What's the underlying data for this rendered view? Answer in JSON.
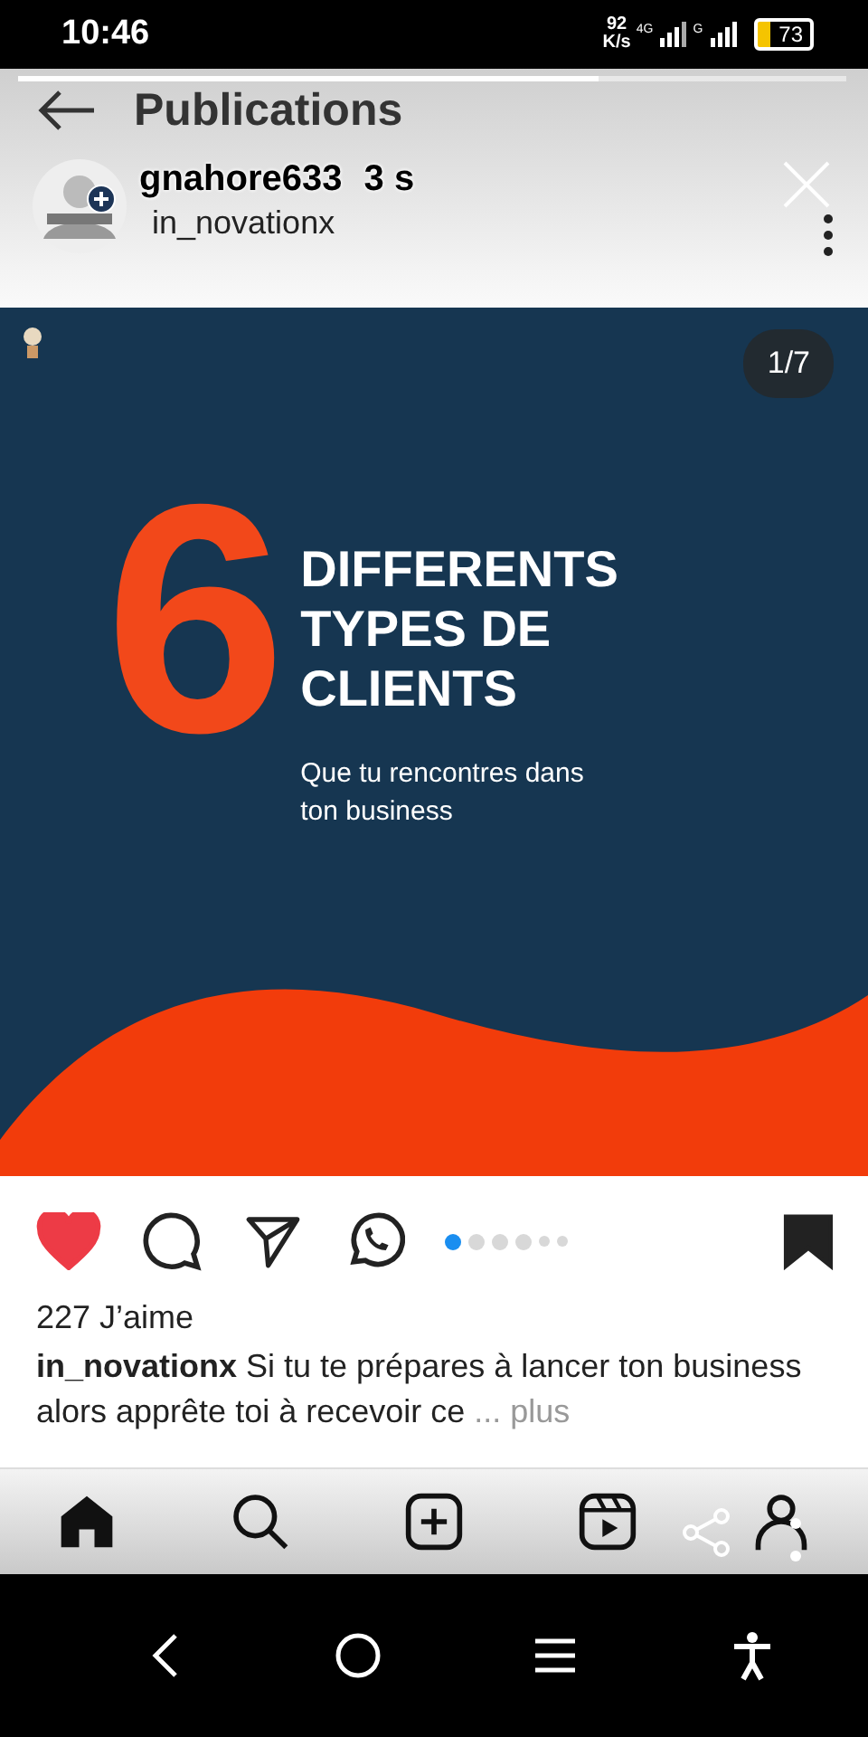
{
  "status_bar": {
    "time": "10:46",
    "speed_value": "92",
    "speed_unit": "K/s",
    "network_1": "4G",
    "network_2": "G",
    "battery": "73"
  },
  "viewer": {
    "progress": {
      "level": 0.7
    },
    "owner": "gnahore633",
    "age": "3 s"
  },
  "screenshot": {
    "title": "Publications",
    "account": "in_novationx",
    "slide": {
      "counter": "1/7",
      "number": "6",
      "headline": [
        "DIFFERENTS",
        "TYPES DE",
        "CLIENTS"
      ],
      "subtitle": [
        "Que tu rencontres dans",
        "ton business"
      ]
    },
    "liked": true,
    "saved": true,
    "carousel_dots": [
      {
        "selected": true
      },
      {
        "selected": false
      },
      {
        "selected": false
      },
      {
        "selected": false
      },
      {
        "selected": false
      },
      {
        "selected": false
      }
    ],
    "likes": "227 J’aime",
    "caption_user": "in_novationx",
    "caption": "Si tu te prépares à lancer ton business alors apprête toi à recevoir ce",
    "more": "... plus"
  }
}
